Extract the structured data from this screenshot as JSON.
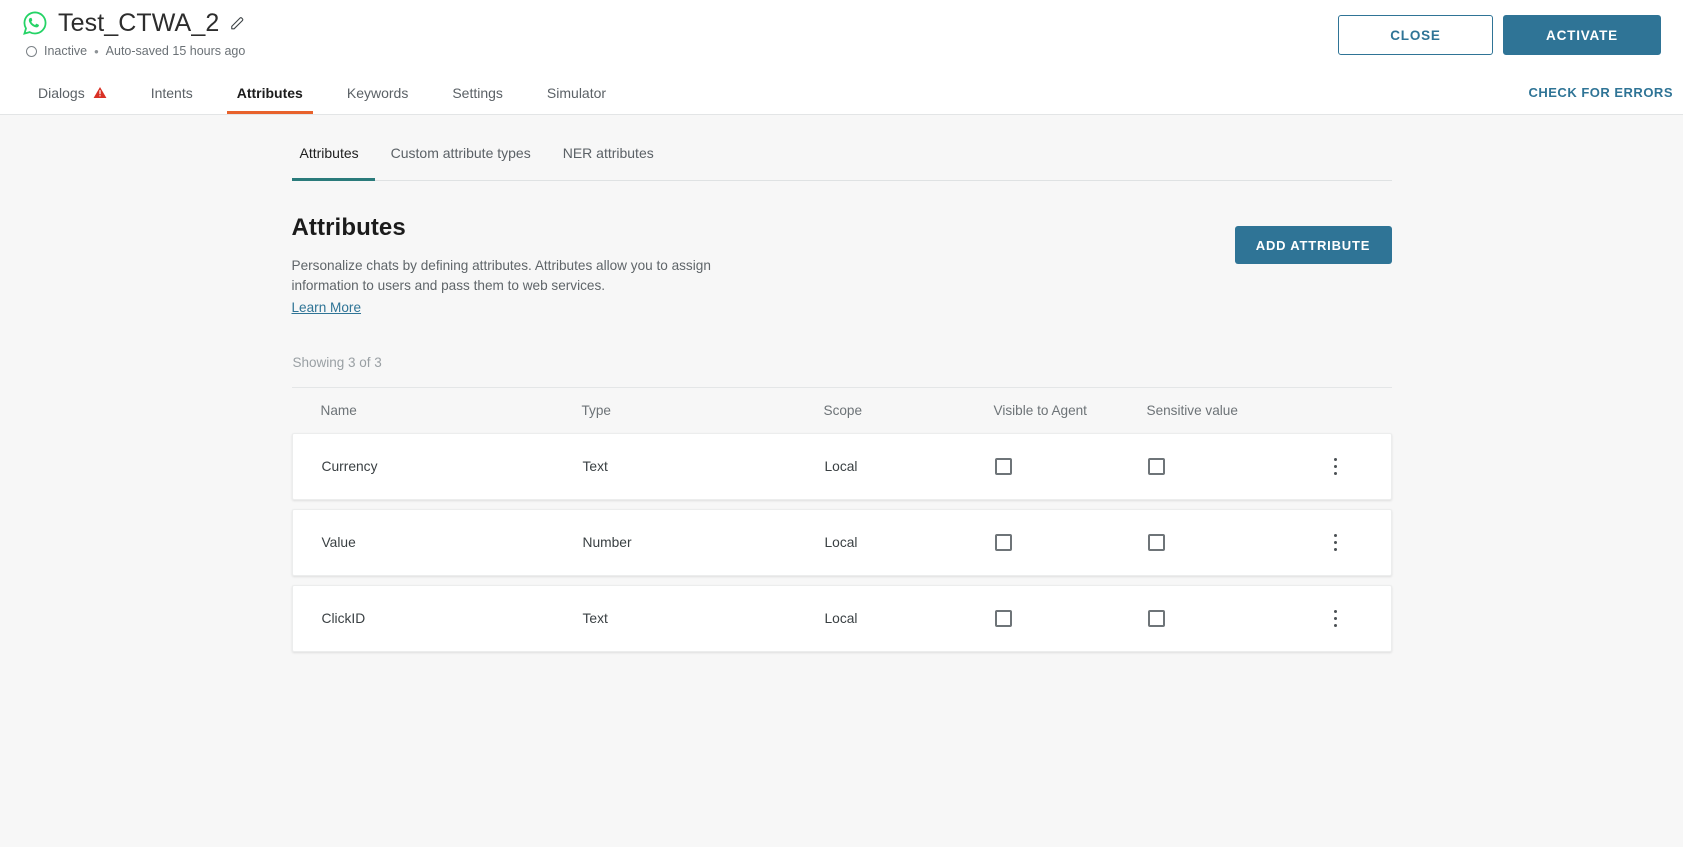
{
  "header": {
    "bot_title": "Test_CTWA_2",
    "channel_icon": "whatsapp-icon",
    "edit_icon": "pencil-icon",
    "status": "Inactive",
    "separator": "•",
    "autosave": "Auto-saved 15 hours ago",
    "close_label": "CLOSE",
    "activate_label": "ACTIVATE",
    "accent_teal": "#2f7496"
  },
  "nav": {
    "tabs": [
      {
        "label": "Dialogs",
        "icon": "warning-triangle-icon",
        "active": false
      },
      {
        "label": "Intents",
        "icon": "",
        "active": false
      },
      {
        "label": "Attributes",
        "icon": "",
        "active": true
      },
      {
        "label": "Keywords",
        "icon": "",
        "active": false
      },
      {
        "label": "Settings",
        "icon": "",
        "active": false
      },
      {
        "label": "Simulator",
        "icon": "",
        "active": false
      }
    ],
    "active_underline_color": "#e8622c",
    "warning_color": "#d93025",
    "check_errors_label": "CHECK FOR ERRORS"
  },
  "subtabs": {
    "items": [
      {
        "label": "Attributes",
        "active": true
      },
      {
        "label": "Custom attribute types",
        "active": false
      },
      {
        "label": "NER attributes",
        "active": false
      }
    ],
    "active_underline_color": "#2a7b7b"
  },
  "section": {
    "title": "Attributes",
    "description": "Personalize chats by defining attributes. Attributes allow you to assign information to users and pass them to web services.",
    "learn_more_label": "Learn More",
    "add_button_label": "ADD ATTRIBUTE",
    "showing_label": "Showing 3 of 3"
  },
  "table": {
    "columns": [
      "Name",
      "Type",
      "Scope",
      "Visible to Agent",
      "Sensitive value"
    ],
    "rows": [
      {
        "name": "Currency",
        "type": "Text",
        "scope": "Local",
        "visible_to_agent": false,
        "sensitive_value": false,
        "menu_icon": "kebab-menu-icon"
      },
      {
        "name": "Value",
        "type": "Number",
        "scope": "Local",
        "visible_to_agent": false,
        "sensitive_value": false,
        "menu_icon": "kebab-menu-icon"
      },
      {
        "name": "ClickID",
        "type": "Text",
        "scope": "Local",
        "visible_to_agent": false,
        "sensitive_value": false,
        "menu_icon": "kebab-menu-icon"
      }
    ]
  }
}
